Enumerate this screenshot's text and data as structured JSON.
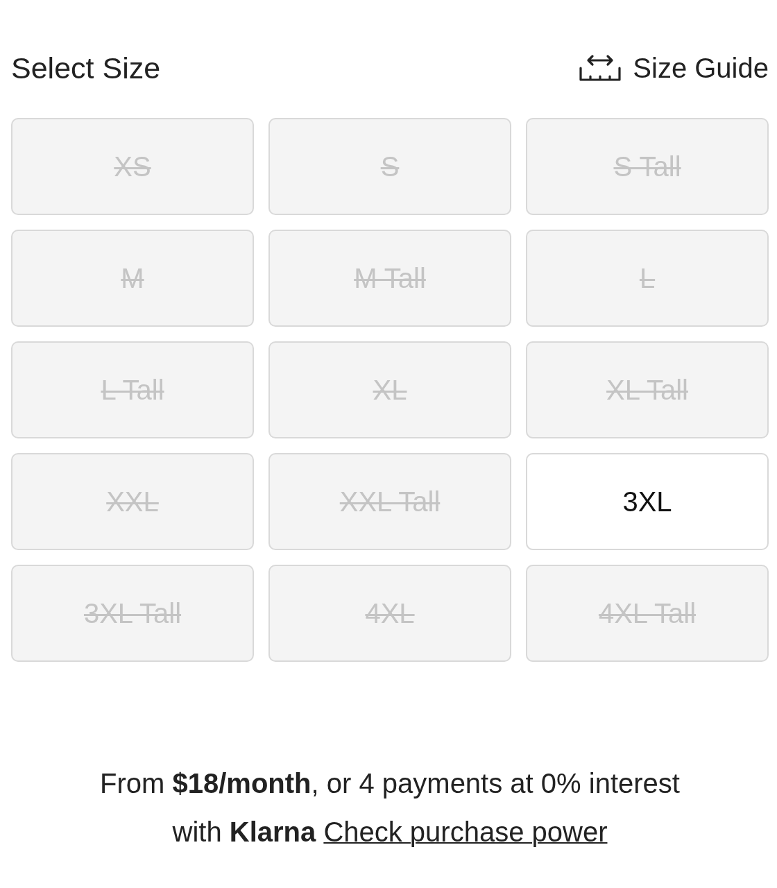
{
  "header": {
    "title": "Select Size",
    "size_guide": "Size Guide"
  },
  "sizes": [
    {
      "label": "XS",
      "available": false
    },
    {
      "label": "S",
      "available": false
    },
    {
      "label": "S Tall",
      "available": false
    },
    {
      "label": "M",
      "available": false
    },
    {
      "label": "M Tall",
      "available": false
    },
    {
      "label": "L",
      "available": false
    },
    {
      "label": "L Tall",
      "available": false
    },
    {
      "label": "XL",
      "available": false
    },
    {
      "label": "XL Tall",
      "available": false
    },
    {
      "label": "XXL",
      "available": false
    },
    {
      "label": "XXL Tall",
      "available": false
    },
    {
      "label": "3XL",
      "available": true
    },
    {
      "label": "3XL Tall",
      "available": false
    },
    {
      "label": "4XL",
      "available": false
    },
    {
      "label": "4XL Tall",
      "available": false
    }
  ],
  "financing": {
    "text": "From **$18/month**, or 4 payments at 0% interest with **Klarna**",
    "link": "Check purchase power"
  }
}
